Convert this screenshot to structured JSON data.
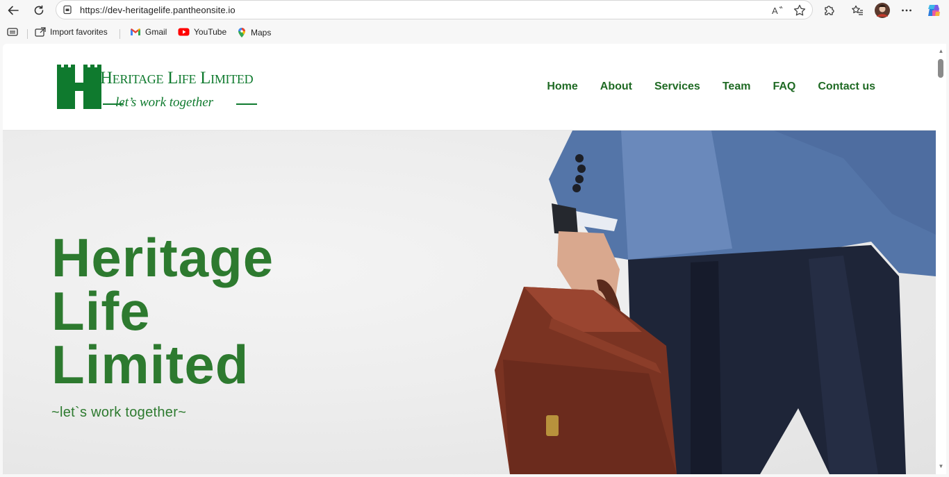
{
  "browser": {
    "url": "https://dev-heritagelife.pantheonsite.io",
    "bookmarks": [
      {
        "label": "Import favorites"
      },
      {
        "label": "Gmail"
      },
      {
        "label": "YouTube"
      },
      {
        "label": "Maps"
      }
    ]
  },
  "site": {
    "logo": {
      "name": "Heritage Life Limited",
      "tagline": "let’s work together"
    },
    "nav": [
      "Home",
      "About",
      "Services",
      "Team",
      "FAQ",
      "Contact us"
    ],
    "hero": {
      "title_lines": [
        "Heritage",
        "Life",
        "Limited"
      ],
      "subtitle": "~let`s work together~"
    }
  },
  "colors": {
    "brand_green": "#0f7a2e",
    "hero_green": "#2d7a2f",
    "nav_green": "#1f6a24"
  }
}
